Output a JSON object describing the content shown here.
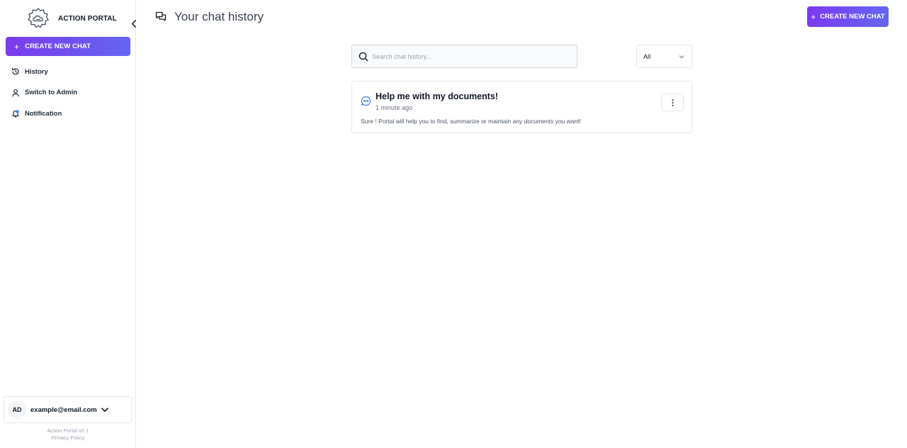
{
  "sidebar": {
    "brand_name": "ACTION PORTAL",
    "create_button_label": "CREATE NEW CHAT",
    "nav_items": [
      {
        "label": "History",
        "icon": "history-icon"
      },
      {
        "label": "Switch to Admin",
        "icon": "user-icon"
      },
      {
        "label": "Notification",
        "icon": "bell-icon"
      }
    ],
    "user": {
      "initials": "AD",
      "email": "example@email.com"
    },
    "footer": {
      "version": "Action Portal v0.1",
      "privacy_link": "Privacy Policy"
    }
  },
  "header": {
    "title": "Your chat history",
    "create_button_label": "CREATE NEW CHAT"
  },
  "search": {
    "placeholder": "Search chat history...",
    "value": ""
  },
  "filter": {
    "selected": "All"
  },
  "chats": [
    {
      "title": "Help me with my documents!",
      "time": "1 minute ago",
      "preview": "Sure ! Portal will help you to find, summarize or maintain any documents you want!"
    }
  ],
  "colors": {
    "accent_start": "#7c3aed",
    "accent_end": "#6366f1",
    "notification_dot": "#3b82f6",
    "chat_icon": "#3b82f6"
  }
}
